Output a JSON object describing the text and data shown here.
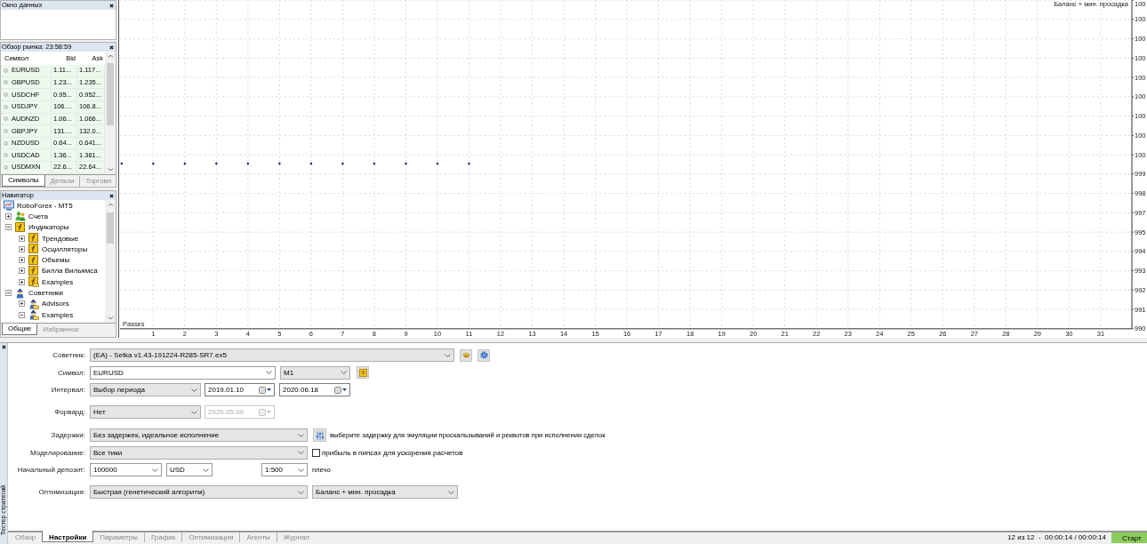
{
  "data_window": {
    "title": "Окно данных"
  },
  "market_watch": {
    "title": "Обзор рынка: 23:58:59",
    "columns": [
      "Символ",
      "Bid",
      "Ask"
    ],
    "rows": [
      {
        "symbol": "EURUSD",
        "bid": "1.11...",
        "ask": "1.117..."
      },
      {
        "symbol": "GBPUSD",
        "bid": "1.23...",
        "ask": "1.235..."
      },
      {
        "symbol": "USDCHF",
        "bid": "0.95...",
        "ask": "0.952..."
      },
      {
        "symbol": "USDJPY",
        "bid": "106....",
        "ask": "106.8..."
      },
      {
        "symbol": "AUDNZD",
        "bid": "1.06...",
        "ask": "1.066..."
      },
      {
        "symbol": "GBPJPY",
        "bid": "131....",
        "ask": "132.0..."
      },
      {
        "symbol": "NZDUSD",
        "bid": "0.64...",
        "ask": "0.641..."
      },
      {
        "symbol": "USDCAD",
        "bid": "1.36...",
        "ask": "1.361..."
      },
      {
        "symbol": "USDMXN",
        "bid": "22.6...",
        "ask": "22.64..."
      }
    ],
    "tabs": [
      {
        "label": "Символы",
        "selected": true
      },
      {
        "label": "Детали",
        "selected": false
      },
      {
        "label": "Торговл",
        "selected": false
      }
    ]
  },
  "navigator": {
    "title": "Навигатор",
    "tree": [
      {
        "label": "RoboForex - MT5",
        "kind": "terminal",
        "children": [
          {
            "label": "Счета",
            "kind": "accounts",
            "expanded": false
          },
          {
            "label": "Индикаторы",
            "kind": "indicator",
            "expanded": true,
            "children": [
              {
                "label": "Трендовые",
                "kind": "indicator",
                "expanded": false
              },
              {
                "label": "Осцилляторы",
                "kind": "indicator",
                "expanded": false
              },
              {
                "label": "Объемы",
                "kind": "indicator",
                "expanded": false
              },
              {
                "label": "Билла Вильямса",
                "kind": "indicator",
                "expanded": false
              },
              {
                "label": "Examples",
                "kind": "indicator-folder",
                "expanded": false
              }
            ]
          },
          {
            "label": "Советники",
            "kind": "expert",
            "expanded": true,
            "children": [
              {
                "label": "Advisors",
                "kind": "expert-folder",
                "expanded": false
              },
              {
                "label": "Examples",
                "kind": "expert-folder",
                "expanded": true
              }
            ]
          }
        ]
      }
    ],
    "tabs": [
      {
        "label": "Общие",
        "selected": true
      },
      {
        "label": "Избранное",
        "selected": false
      }
    ]
  },
  "chart": {
    "title": "Баланс + мин. просадка",
    "x_axis_title": "Passes",
    "x_axis_labels": [
      "1",
      "2",
      "3",
      "4",
      "5",
      "6",
      "7",
      "8",
      "9",
      "10",
      "11",
      "12",
      "13",
      "14",
      "15",
      "16",
      "17",
      "18",
      "19",
      "20",
      "21",
      "22",
      "23",
      "24",
      "25",
      "26",
      "27",
      "28",
      "29",
      "30",
      "31"
    ],
    "y_axis_labels": [
      "100",
      "100",
      "100",
      "100",
      "100",
      "100",
      "100",
      "100",
      "100",
      "999",
      "998",
      "997",
      "995",
      "994",
      "993",
      "992",
      "991",
      "990"
    ]
  },
  "tester": {
    "title": "Тестер стратегий",
    "fields": [
      {
        "label": "Советник:",
        "controls": [
          {
            "kind": "dropdown",
            "value": "(EA) - Setka v1.43-191224-R285-SR7.ex5"
          },
          {
            "kind": "icon-button"
          },
          {
            "kind": "icon-button"
          }
        ]
      },
      {
        "label": "Символ:",
        "controls": [
          {
            "kind": "combo",
            "value": "EURUSD"
          },
          {
            "kind": "dropdown",
            "value": "M1"
          },
          {
            "kind": "icon-button"
          }
        ]
      },
      {
        "label": "Интервал:",
        "controls": [
          {
            "kind": "dropdown",
            "value": "Выбор периода"
          },
          {
            "kind": "date",
            "value": "2019.01.10",
            "disabled": false
          },
          {
            "kind": "date",
            "value": "2020.06.18",
            "disabled": false
          }
        ]
      },
      {
        "label": "Форвард:",
        "controls": [
          {
            "kind": "dropdown",
            "value": "Нет"
          },
          {
            "kind": "date",
            "value": "2020.05.09",
            "disabled": true
          }
        ]
      },
      {
        "label": "Задержки:",
        "controls": [
          {
            "kind": "dropdown",
            "value": "Без задержек, идеальное исполнение"
          },
          {
            "kind": "icon-button"
          },
          {
            "kind": "text",
            "text": "выберите задержку для эмуляции проскальзываний и реквотов при исполнении сделок"
          }
        ]
      },
      {
        "label": "Моделирование:",
        "controls": [
          {
            "kind": "dropdown",
            "value": "Все тики"
          },
          {
            "kind": "checkbox",
            "checked": false,
            "label": "прибыль в пипсах для ускорения расчетов"
          }
        ]
      },
      {
        "label": "Начальный депозит:",
        "controls": [
          {
            "kind": "combo",
            "value": "100000"
          },
          {
            "kind": "combo",
            "value": "USD"
          },
          {
            "kind": "combo",
            "value": "1:500"
          },
          {
            "kind": "text",
            "text": "плечо"
          }
        ]
      },
      {
        "label": "Оптимизация:",
        "controls": [
          {
            "kind": "dropdown",
            "value": "Быстрая (генетический алгоритм)"
          },
          {
            "kind": "dropdown",
            "value": "Баланс + мин. просадка"
          }
        ]
      }
    ],
    "tabs": [
      {
        "label": "Обзор",
        "selected": false
      },
      {
        "label": "Настройки",
        "selected": true
      },
      {
        "label": "Параметры",
        "selected": false
      },
      {
        "label": "График",
        "selected": false
      },
      {
        "label": "Оптимизация",
        "selected": false
      },
      {
        "label": "Агенты",
        "selected": false
      },
      {
        "label": "Журнал",
        "selected": false
      }
    ],
    "progress": "12 из 12  -  00:00:14 / 00:00:14",
    "start_button": "Старт"
  }
}
